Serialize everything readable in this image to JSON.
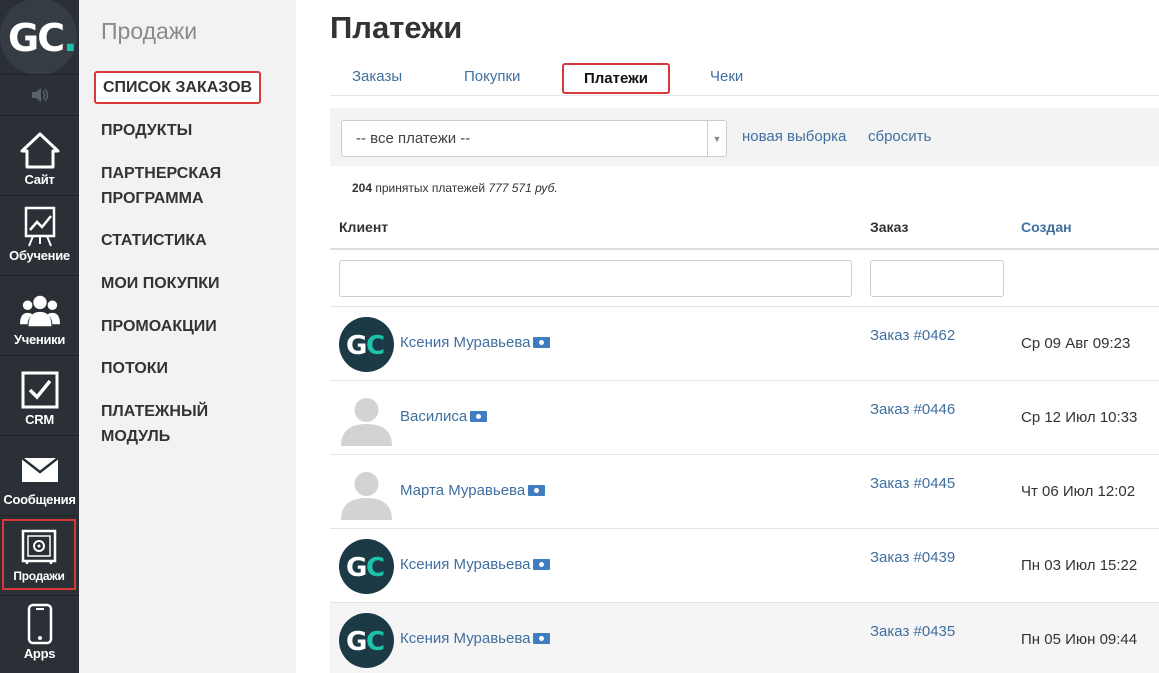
{
  "logo": {
    "text": "GC",
    "dot": "."
  },
  "rail": {
    "items": [
      {
        "label": "Сайт",
        "icon": "house-icon"
      },
      {
        "label": "Обучение",
        "icon": "chart-board-icon"
      },
      {
        "label": "Ученики",
        "icon": "users-icon"
      },
      {
        "label": "CRM",
        "icon": "checkbox-icon"
      },
      {
        "label": "Сообщения",
        "icon": "envelope-icon"
      },
      {
        "label": "Продажи",
        "icon": "safe-icon"
      },
      {
        "label": "Apps",
        "icon": "phone-icon"
      }
    ]
  },
  "submenu": {
    "title": "Продажи",
    "items": [
      {
        "label": "СПИСОК ЗАКАЗОВ"
      },
      {
        "label": "ПРОДУКТЫ"
      },
      {
        "label": "ПАРТНЕРСКАЯ"
      },
      {
        "label": "ПРОГРАММА"
      },
      {
        "label": "СТАТИСТИКА"
      },
      {
        "label": "МОИ ПОКУПКИ"
      },
      {
        "label": "ПРОМОАКЦИИ"
      },
      {
        "label": "ПОТОКИ"
      },
      {
        "label": "ПЛАТЕЖНЫЙ"
      },
      {
        "label": "МОДУЛЬ"
      }
    ]
  },
  "page": {
    "title": "Платежи"
  },
  "tabs": [
    {
      "label": "Заказы"
    },
    {
      "label": "Покупки"
    },
    {
      "label": "Платежи",
      "active": true
    },
    {
      "label": "Чеки"
    }
  ],
  "filter": {
    "select_value": "-- все платежи --",
    "new_selection": "новая выборка",
    "reset": "сбросить"
  },
  "summary": {
    "count": "204",
    "text": "принятых платежей",
    "amount": "777 571 руб."
  },
  "table": {
    "columns": {
      "client": "Клиент",
      "order": "Заказ",
      "created": "Создан"
    },
    "rows": [
      {
        "name": "Ксения Муравьева",
        "avatar": "gc-logo-avatar",
        "order": "Заказ #0462",
        "created": "Ср 09 Авг 09:23"
      },
      {
        "name": "Василиса",
        "avatar": "default-user-avatar",
        "order": "Заказ #0446",
        "created": "Ср 12 Июл 10:33"
      },
      {
        "name": "Марта Муравьева",
        "avatar": "default-user-avatar",
        "order": "Заказ #0445",
        "created": "Чт 06 Июл 12:02"
      },
      {
        "name": "Ксения Муравьева",
        "avatar": "gc-logo-avatar",
        "order": "Заказ #0439",
        "created": "Пн 03 Июл 15:22"
      },
      {
        "name": "Ксения Муравьева",
        "avatar": "gc-logo-avatar",
        "order": "Заказ #0435",
        "created": "Пн 05 Июн 09:44"
      }
    ]
  },
  "colors": {
    "accent": "#3f6fa0",
    "highlight": "#d9383a",
    "rail": "#2a3036",
    "brand_teal": "#1cc3a8"
  }
}
